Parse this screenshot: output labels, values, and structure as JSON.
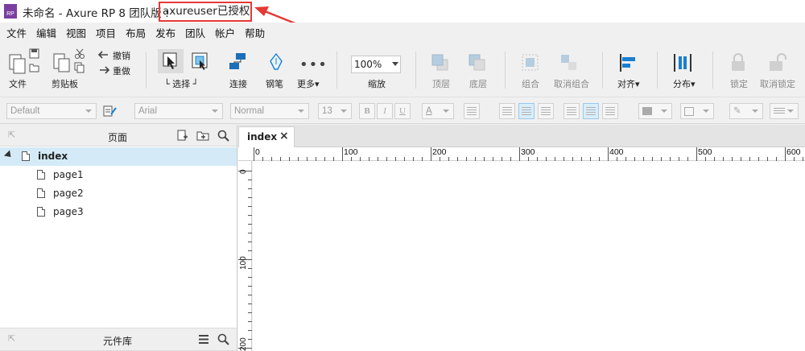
{
  "title_bar": {
    "app_logo": "RP",
    "title": "未命名 - Axure RP 8 团队版 :",
    "license": "axureuser已授权"
  },
  "menu": [
    "文件",
    "编辑",
    "视图",
    "项目",
    "布局",
    "发布",
    "团队",
    "帐户",
    "帮助"
  ],
  "toolbar": {
    "file": "文件",
    "clipboard": "剪贴板",
    "undo": "撤销",
    "redo": "重做",
    "select": "选择",
    "connect": "连接",
    "pen": "钢笔",
    "more": "更多",
    "zoom_value": "100%",
    "zoom": "缩放",
    "top_layer": "顶层",
    "bottom_layer": "底层",
    "group": "组合",
    "ungroup": "取消组合",
    "align": "对齐",
    "distribute": "分布",
    "lock": "锁定",
    "unlock": "取消锁定"
  },
  "format_bar": {
    "style": "Default",
    "font": "Arial",
    "weight": "Normal",
    "size": "13",
    "bold": "B",
    "italic": "I",
    "underline": "U",
    "font_color": "A"
  },
  "pages_panel": {
    "title": "页面",
    "pages": [
      {
        "name": "index",
        "selected": true
      },
      {
        "name": "page1"
      },
      {
        "name": "page2"
      },
      {
        "name": "page3"
      }
    ]
  },
  "library_panel": {
    "title": "元件库"
  },
  "canvas": {
    "tab": "index",
    "close": "×",
    "h_ruler": [
      "0",
      "100",
      "200",
      "300",
      "400",
      "500",
      "600"
    ],
    "v_ruler": [
      "0",
      "100",
      "200"
    ]
  },
  "colors": {
    "highlight_box": "#e53935",
    "selection": "#d4ebf7",
    "app_logo": "#7b3fa0",
    "accent": "#1a7fd0"
  }
}
